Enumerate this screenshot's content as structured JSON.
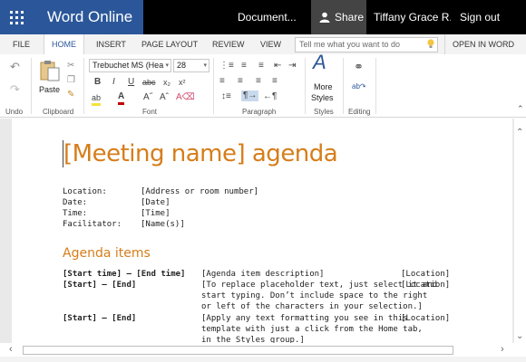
{
  "titlebar": {
    "app_name": "Word Online",
    "document_name": "Document...",
    "share_label": "Share",
    "user_name": "Tiffany Grace R...",
    "signout_label": "Sign out"
  },
  "tabs": {
    "items": [
      "FILE",
      "HOME",
      "INSERT",
      "PAGE LAYOUT",
      "REVIEW",
      "VIEW"
    ],
    "active": "HOME",
    "tell_me_placeholder": "Tell me what you want to do",
    "open_in_word": "OPEN IN WORD"
  },
  "ribbon": {
    "undo_label": "Undo",
    "clipboard_label": "Clipboard",
    "paste_label": "Paste",
    "font_label": "Font",
    "font_name": "Trebuchet MS (Hea",
    "font_size": "28",
    "paragraph_label": "Paragraph",
    "styles_label": "Styles",
    "more_styles_label_1": "More",
    "more_styles_label_2": "Styles",
    "editing_label": "Editing"
  },
  "document": {
    "title": "[Meeting name] agenda",
    "details": [
      {
        "label": "Location:",
        "value": "[Address or room number]"
      },
      {
        "label": "Date:",
        "value": "[Date]"
      },
      {
        "label": "Time:",
        "value": "[Time]"
      },
      {
        "label": "Facilitator:",
        "value": "[Name(s)]"
      }
    ],
    "agenda_heading": "Agenda items",
    "agenda_rows": [
      {
        "time": "[Start time] — [End time]",
        "desc": [
          "[Agenda item description]"
        ],
        "loc": "[Location]"
      },
      {
        "time": "[Start] — [End]",
        "desc": [
          "[To replace placeholder text, just select it and",
          "start typing. Don’t include space to the right",
          "or left of the characters in your selection.]"
        ],
        "loc": "[Location]"
      },
      {
        "time": "[Start] — [End]",
        "desc": [
          "[Apply any text formatting you see in this",
          "template with just a click from the Home tab,",
          "in the Styles group.]"
        ],
        "loc": "[Location]"
      }
    ]
  },
  "colors": {
    "brand_blue": "#2b579a",
    "title_orange": "#d67d1a"
  }
}
